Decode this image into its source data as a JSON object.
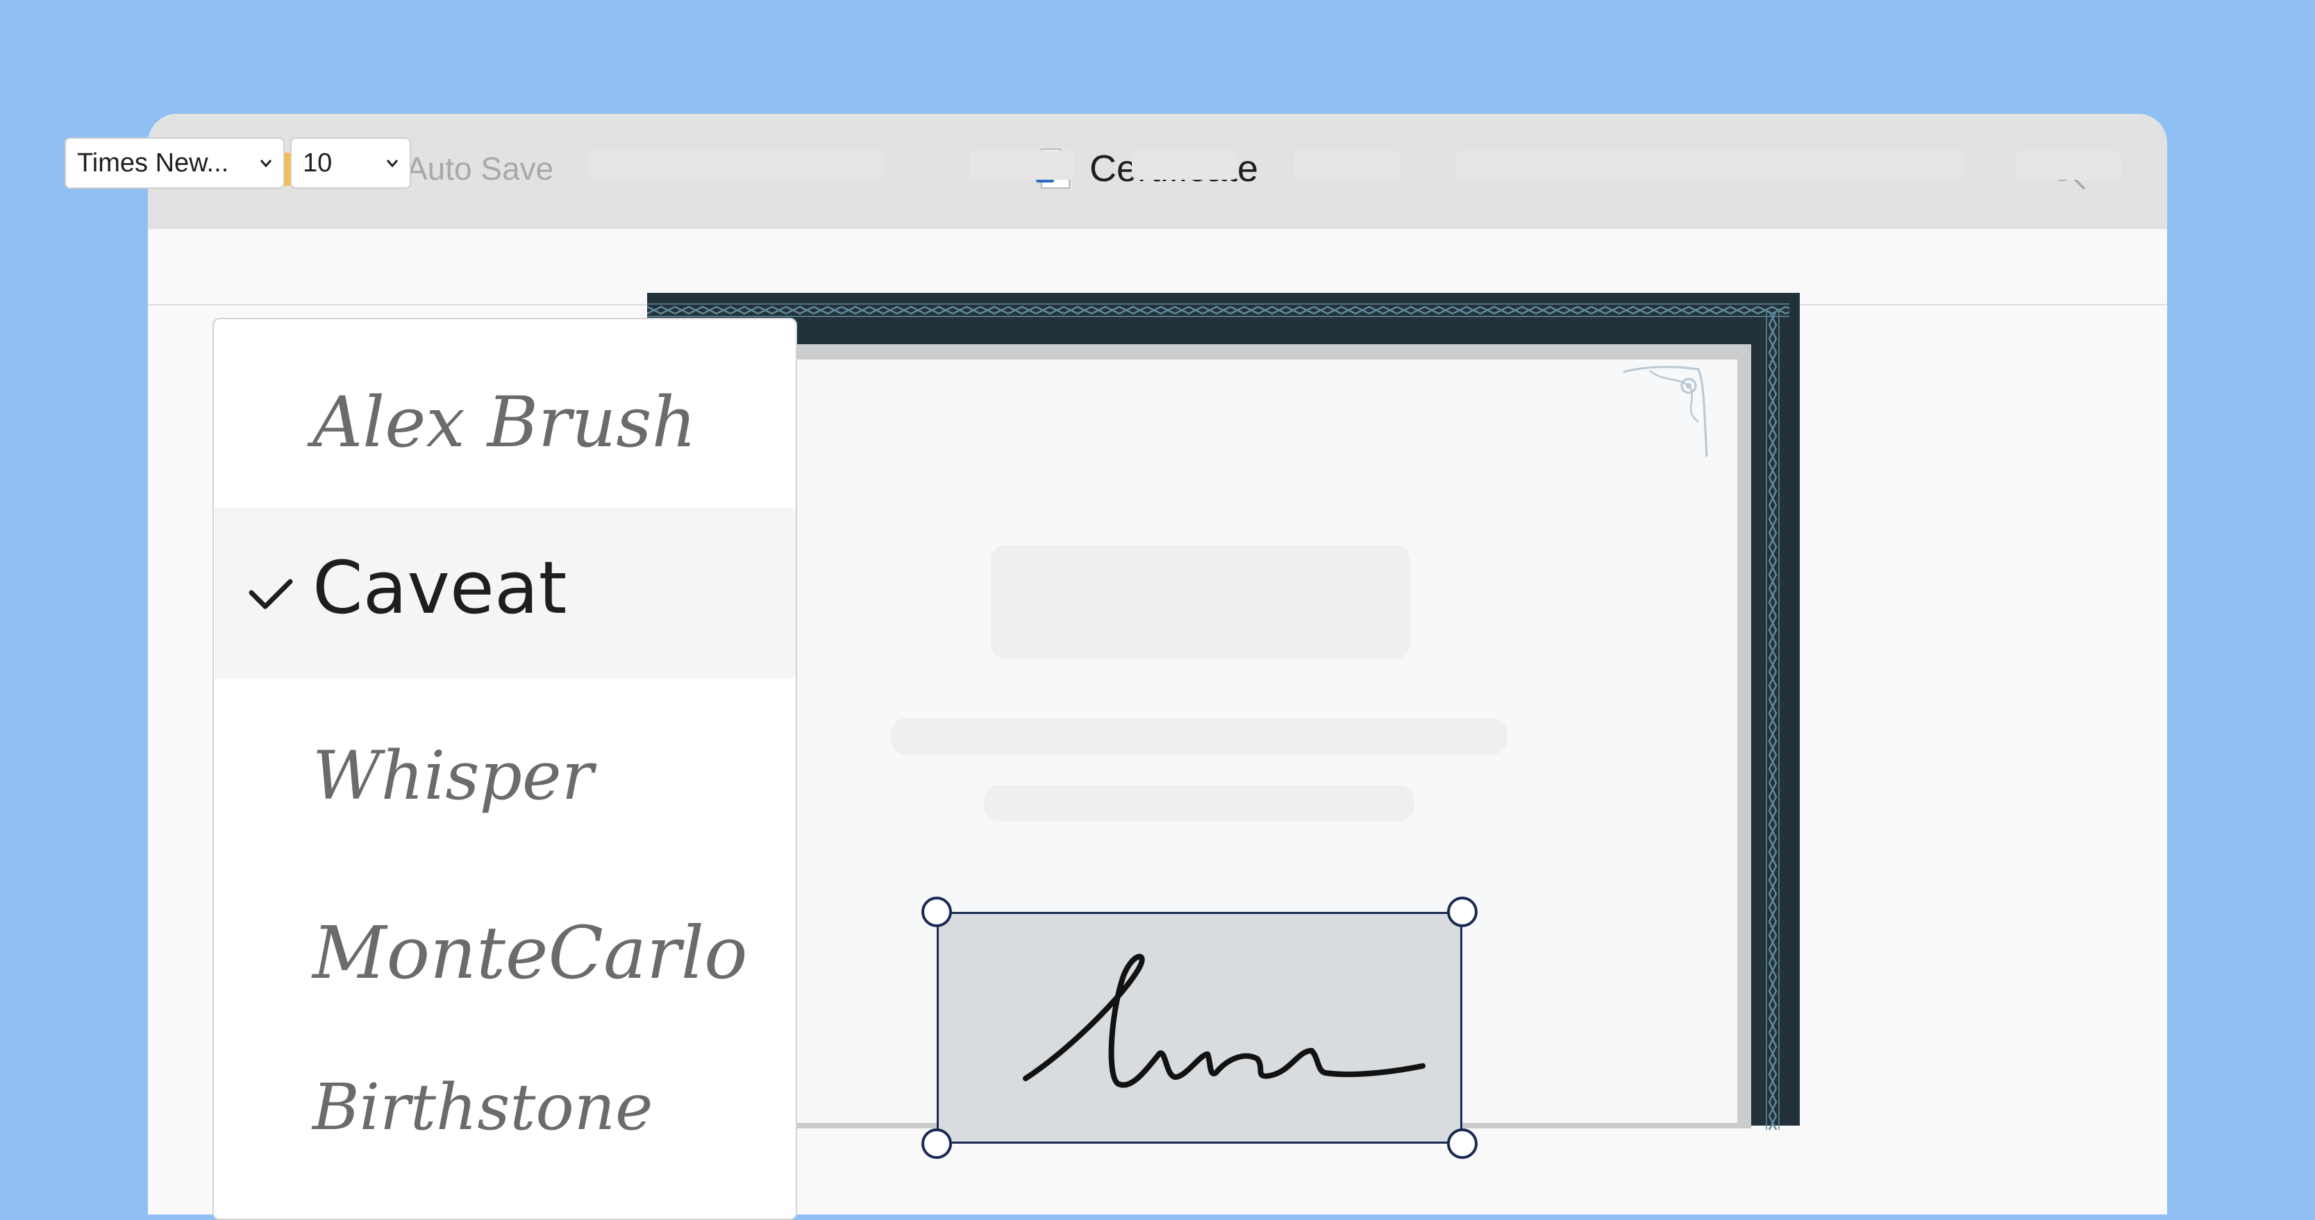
{
  "window": {
    "autosave_label": "Auto Save",
    "document_title": "Certificate",
    "doc_icon_letter": "W"
  },
  "toolbar": {
    "font_family_value": "Times New...",
    "font_size_value": "10"
  },
  "font_dropdown": {
    "items": [
      {
        "label": "Alex Brush",
        "selected": false
      },
      {
        "label": "Caveat",
        "selected": true
      },
      {
        "label": "Whisper",
        "selected": false
      },
      {
        "label": "MonteCarlo",
        "selected": false
      },
      {
        "label": "Birthstone",
        "selected": false
      }
    ]
  },
  "colors": {
    "background": "#8fbff3",
    "titlebar": "#e2e2e2",
    "certificate_frame": "#23323a",
    "certificate_pattern": "#5f8a9c",
    "selection_border": "#1b2a52",
    "signature_fill": "#d9dcdf",
    "word_blue": "#2b6cc4"
  }
}
